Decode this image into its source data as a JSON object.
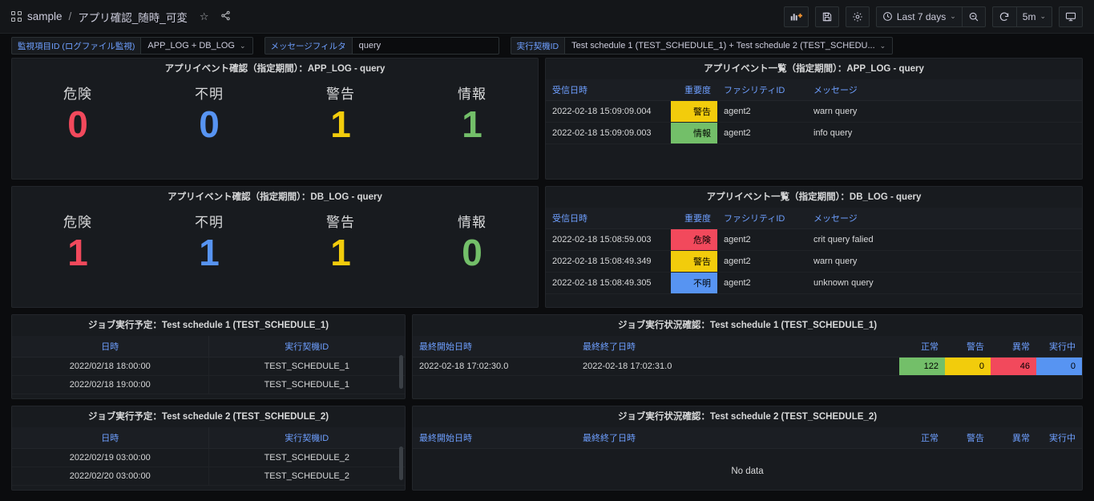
{
  "nav": {
    "folder": "sample",
    "separator": "/",
    "title": "アプリ確認_随時_可変",
    "star_icon": "☆",
    "share_icon": "share-nodes",
    "grid_icon": "dashboard-grid-icon",
    "buttons": {
      "add_panel": "add-panel-icon",
      "save": "save-dashboard-icon",
      "settings": "dashboard-settings-icon",
      "time_range": "Last 7 days",
      "zoom_out": "zoom-out-icon",
      "refresh": "refresh-icon",
      "refresh_interval": "5m",
      "kiosk": "tv-mode-icon"
    }
  },
  "variables": [
    {
      "label": "監視項目ID (ログファイル監視)",
      "value": "APP_LOG + DB_LOG",
      "type": "select"
    },
    {
      "label": "メッセージフィルタ",
      "value": "query",
      "placeholder": "query",
      "type": "textbox"
    },
    {
      "label": "実行契機ID",
      "value": "Test schedule 1 (TEST_SCHEDULE_1) + Test schedule 2 (TEST_SCHEDU...",
      "type": "select"
    }
  ],
  "colors": {
    "red": "#F2495C",
    "blue": "#5794F2",
    "yellow": "#F2CC0C",
    "green": "#73BF69",
    "header_blue": "#6E9FFF",
    "panel_bg": "#181B1F",
    "page_bg": "#0B0C0E"
  },
  "panels": {
    "stat_app": {
      "title": "アプリイベント確認（指定期間）：APP_LOG - query",
      "cells": [
        {
          "label": "危険",
          "value": "0",
          "color": "#F2495C"
        },
        {
          "label": "不明",
          "value": "0",
          "color": "#5794F2"
        },
        {
          "label": "警告",
          "value": "1",
          "color": "#F2CC0C"
        },
        {
          "label": "情報",
          "value": "1",
          "color": "#73BF69"
        }
      ]
    },
    "stat_db": {
      "title": "アプリイベント確認（指定期間）：DB_LOG - query",
      "cells": [
        {
          "label": "危険",
          "value": "1",
          "color": "#F2495C"
        },
        {
          "label": "不明",
          "value": "1",
          "color": "#5794F2"
        },
        {
          "label": "警告",
          "value": "1",
          "color": "#F2CC0C"
        },
        {
          "label": "情報",
          "value": "0",
          "color": "#73BF69"
        }
      ]
    },
    "table_app": {
      "title": "アプリイベント一覧（指定期間）：APP_LOG - query",
      "columns": [
        "受信日時",
        "重要度",
        "ファシリティID",
        "メッセージ"
      ],
      "rows": [
        {
          "time": "2022-02-18 15:09:09.004",
          "severity": "警告",
          "severity_color": "#F2CC0C",
          "facility": "agent2",
          "message": "warn query"
        },
        {
          "time": "2022-02-18 15:09:09.003",
          "severity": "情報",
          "severity_color": "#73BF69",
          "facility": "agent2",
          "message": "info query"
        }
      ]
    },
    "table_db": {
      "title": "アプリイベント一覧（指定期間）：DB_LOG - query",
      "columns": [
        "受信日時",
        "重要度",
        "ファシリティID",
        "メッセージ"
      ],
      "rows": [
        {
          "time": "2022-02-18 15:08:59.003",
          "severity": "危険",
          "severity_color": "#F2495C",
          "facility": "agent2",
          "message": "crit query falied"
        },
        {
          "time": "2022-02-18 15:08:49.349",
          "severity": "警告",
          "severity_color": "#F2CC0C",
          "facility": "agent2",
          "message": "warn query"
        },
        {
          "time": "2022-02-18 15:08:49.305",
          "severity": "不明",
          "severity_color": "#5794F2",
          "facility": "agent2",
          "message": "unknown query"
        }
      ]
    },
    "sched1": {
      "title": "ジョブ実行予定：Test schedule 1 (TEST_SCHEDULE_1)",
      "columns": [
        "日時",
        "実行契機ID"
      ],
      "rows": [
        {
          "datetime": "2022/02/18 18:00:00",
          "trigger": "TEST_SCHEDULE_1"
        },
        {
          "datetime": "2022/02/18 19:00:00",
          "trigger": "TEST_SCHEDULE_1"
        }
      ]
    },
    "sched2": {
      "title": "ジョブ実行予定：Test schedule 2 (TEST_SCHEDULE_2)",
      "columns": [
        "日時",
        "実行契機ID"
      ],
      "rows": [
        {
          "datetime": "2022/02/19 03:00:00",
          "trigger": "TEST_SCHEDULE_2"
        },
        {
          "datetime": "2022/02/20 03:00:00",
          "trigger": "TEST_SCHEDULE_2"
        }
      ]
    },
    "status1": {
      "title": "ジョブ実行状況確認：Test schedule 1 (TEST_SCHEDULE_1)",
      "columns": [
        "最終開始日時",
        "最終終了日時",
        "正常",
        "警告",
        "異常",
        "実行中"
      ],
      "rows": [
        {
          "start": "2022-02-18 17:02:30.0",
          "end": "2022-02-18 17:02:31.0",
          "normal": "122",
          "normal_color": "#73BF69",
          "warn": "0",
          "warn_color": "#F2CC0C",
          "error": "46",
          "error_color": "#F2495C",
          "running": "0",
          "running_color": "#5794F2"
        }
      ],
      "empty_text": ""
    },
    "status2": {
      "title": "ジョブ実行状況確認：Test schedule 2 (TEST_SCHEDULE_2)",
      "columns": [
        "最終開始日時",
        "最終終了日時",
        "正常",
        "警告",
        "異常",
        "実行中"
      ],
      "rows": [],
      "empty_text": "No data"
    }
  }
}
